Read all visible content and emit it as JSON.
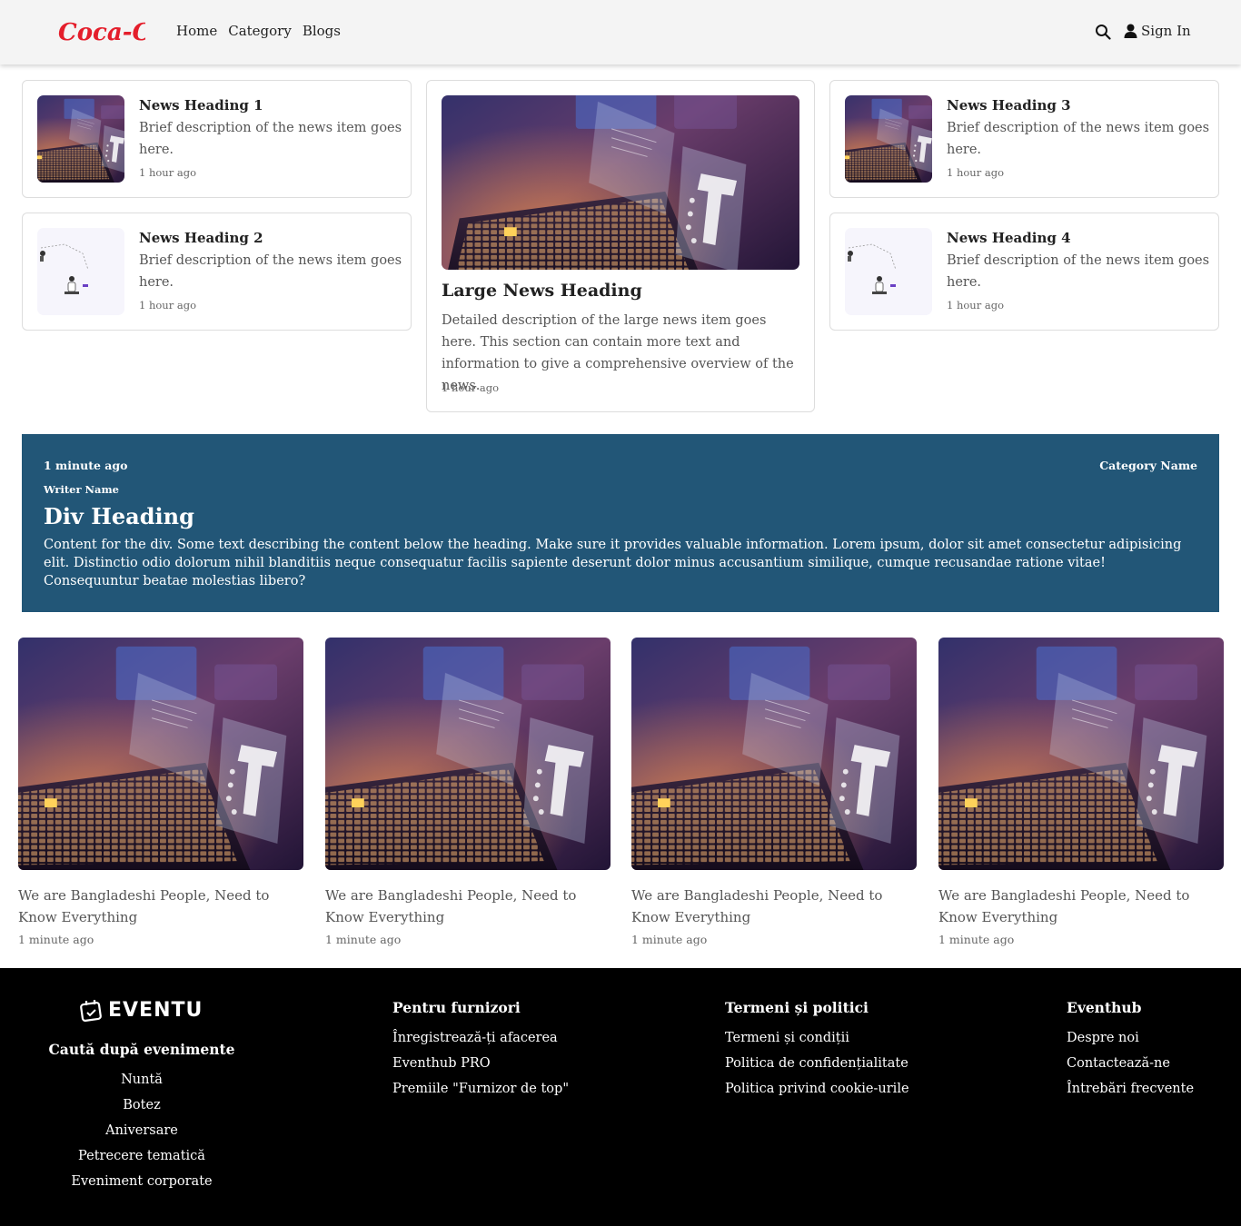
{
  "header": {
    "logo_text": "Coca-Cola",
    "nav": [
      {
        "label": "Home"
      },
      {
        "label": "Category"
      },
      {
        "label": "Blogs"
      }
    ],
    "sign_in": "Sign In"
  },
  "news_cards": [
    {
      "title": "News Heading 1",
      "description": "Brief description of the news item goes here.",
      "time": "1 hour ago"
    },
    {
      "title": "News Heading 2",
      "description": "Brief description of the news item goes here.",
      "time": "1 hour ago"
    },
    {
      "title": "News Heading 3",
      "description": "Brief description of the news item goes here.",
      "time": "1 hour ago"
    },
    {
      "title": "News Heading 4",
      "description": "Brief description of the news item goes here.",
      "time": "1 hour ago"
    }
  ],
  "large_news": {
    "title": "Large News Heading",
    "description": "Detailed description of the large news item goes here. This section can contain more text and information to give a comprehensive overview of the news.",
    "time": "1 hour ago"
  },
  "banner": {
    "time": "1 minute ago",
    "category": "Category Name",
    "writer": "Writer Name",
    "heading": "Div Heading",
    "content": "Content for the div. Some text describing the content below the heading. Make sure it provides valuable information. Lorem ipsum, dolor sit amet consectetur adipisicing elit. Distinctio odio dolorum nihil blanditiis neque consequatur facilis sapiente deserunt dolor minus accusantium similique, cumque recusandae ratione vitae! Consequuntur beatae molestias libero?"
  },
  "articles": [
    {
      "title": "We are Bangladeshi People, Need to Know Everything",
      "time": "1 minute ago"
    },
    {
      "title": "We are Bangladeshi People, Need to Know Everything",
      "time": "1 minute ago"
    },
    {
      "title": "We are Bangladeshi People, Need to Know Everything",
      "time": "1 minute ago"
    },
    {
      "title": "We are Bangladeshi People, Need to Know Everything",
      "time": "1 minute ago"
    }
  ],
  "footer": {
    "logo_text": "EVENTU",
    "col1": {
      "heading": "Caută după evenimente",
      "links": [
        "Nuntă",
        "Botez",
        "Aniversare",
        "Petrecere tematică",
        "Eveniment corporate"
      ]
    },
    "col2": {
      "heading": "Pentru furnizori",
      "links": [
        "Înregistrează-ți afacerea",
        "Eventhub PRO",
        "Premiile \"Furnizor de top\""
      ]
    },
    "col3": {
      "heading": "Termeni și politici",
      "links": [
        "Termeni și condiții",
        "Politica de confidențialitate",
        "Politica privind cookie-urile"
      ]
    },
    "col4": {
      "heading": "Eventhub",
      "links": [
        "Despre noi",
        "Contactează-ne",
        "Întrebări frecvente"
      ]
    }
  },
  "colors": {
    "header_bg": "#f4f4f4",
    "banner_bg": "#225677",
    "footer_bg": "#000000",
    "logo_red": "#e41e2b"
  }
}
